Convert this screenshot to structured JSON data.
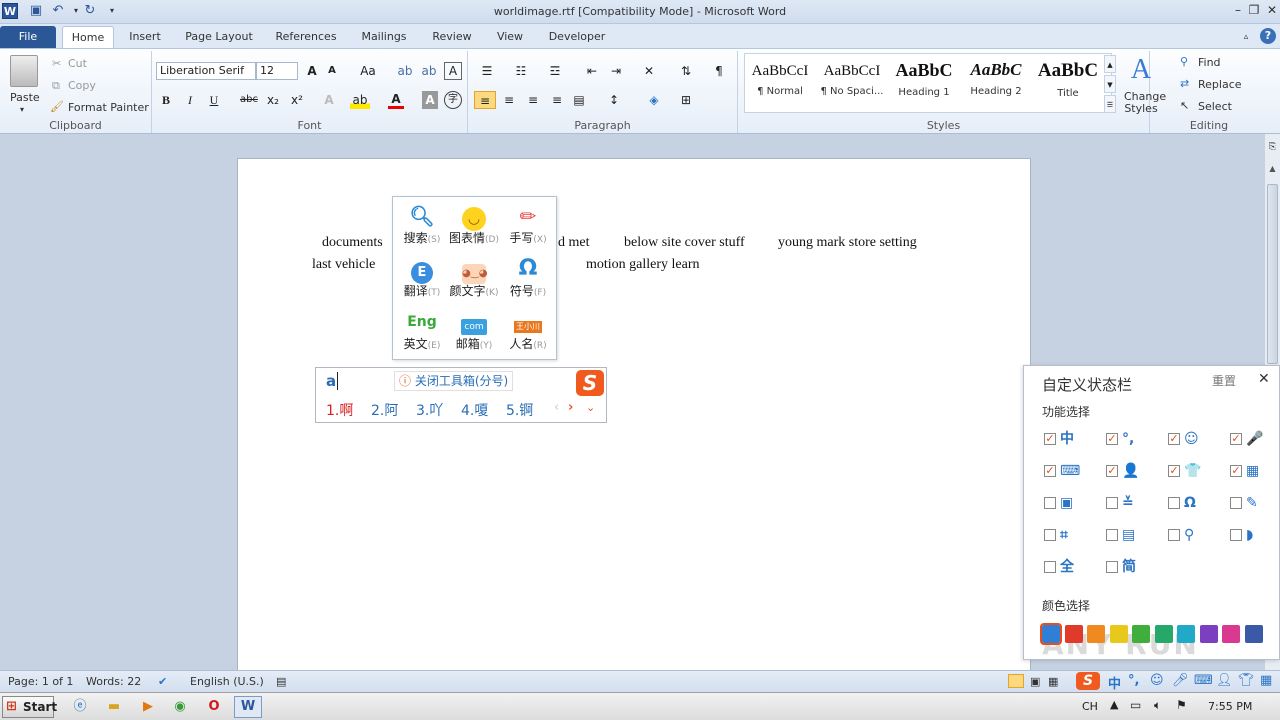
{
  "window": {
    "title": "worldimage.rtf [Compatibility Mode] - Microsoft Word",
    "app_icon": "W"
  },
  "tabs": [
    "File",
    "Home",
    "Insert",
    "Page Layout",
    "References",
    "Mailings",
    "Review",
    "View",
    "Developer"
  ],
  "clipboard": {
    "paste": "Paste",
    "cut": "Cut",
    "copy": "Copy",
    "format_painter": "Format Painter",
    "label": "Clipboard"
  },
  "font": {
    "name": "Liberation Serif",
    "size": "12",
    "label": "Font",
    "bold": "B",
    "italic": "I",
    "underline": "U",
    "strike": "abc",
    "sub": "x₂",
    "sup": "x²"
  },
  "paragraph": {
    "label": "Paragraph",
    "pilcrow": "¶"
  },
  "styles": {
    "label": "Styles",
    "items": [
      {
        "preview": "AaBbCcI",
        "name": "¶ Normal"
      },
      {
        "preview": "AaBbCcI",
        "name": "¶ No Spaci..."
      },
      {
        "preview": "AaBbC",
        "name": "Heading 1"
      },
      {
        "preview": "AaBbC",
        "name": "Heading 2"
      },
      {
        "preview": "AaBbC",
        "name": "Title"
      }
    ],
    "change_styles": "Change Styles"
  },
  "editing": {
    "label": "Editing",
    "find": "Find",
    "replace": "Replace",
    "select": "Select"
  },
  "document": {
    "line1_a": "documents",
    "line1_b": "d  met",
    "line1_c": "below  site  cover  stuff",
    "line1_d": "young  mark  store  setting",
    "line2_a": "last  vehicle",
    "line2_b": "motion  gallery  learn"
  },
  "ime_toolbox": {
    "tools": [
      {
        "label": "搜索",
        "key": "(S)",
        "icon": "search-icon"
      },
      {
        "label": "图表情",
        "key": "(D)",
        "icon": "smiley-icon"
      },
      {
        "label": "手写",
        "key": "(X)",
        "icon": "pencil-icon"
      },
      {
        "label": "翻译",
        "key": "(T)",
        "icon": "translate-icon"
      },
      {
        "label": "颜文字",
        "key": "(K)",
        "icon": "kaomoji-icon"
      },
      {
        "label": "符号",
        "key": "(F)",
        "icon": "omega-icon"
      },
      {
        "label": "英文",
        "key": "(E)",
        "icon": "english-icon"
      },
      {
        "label": "邮箱",
        "key": "(Y)",
        "icon": "email-icon"
      },
      {
        "label": "人名",
        "key": "(R)",
        "icon": "person-icon"
      }
    ],
    "badge_name": "王小川",
    "eng_icon": "Eng",
    "com_icon": "com"
  },
  "ime_candidates": {
    "input": "a",
    "close_hint": "关闭工具箱(分号)",
    "candidates": [
      "1.啊",
      "2.阿",
      "3.吖",
      "4.嗄",
      "5.锕"
    ]
  },
  "custom_panel": {
    "title": "自定义状态栏",
    "reset": "重置",
    "function_label": "功能选择",
    "color_label": "颜色选择",
    "items": [
      {
        "icon": "中",
        "checked": true
      },
      {
        "icon": "°,",
        "checked": true
      },
      {
        "icon": "☺",
        "checked": true
      },
      {
        "icon": "🎤",
        "checked": true
      },
      {
        "icon": "⌨",
        "checked": true
      },
      {
        "icon": "👤",
        "checked": true
      },
      {
        "icon": "👕",
        "checked": true
      },
      {
        "icon": "▦",
        "checked": true
      },
      {
        "icon": "▣",
        "checked": false
      },
      {
        "icon": "≚",
        "checked": false
      },
      {
        "icon": "Ω",
        "checked": false
      },
      {
        "icon": "✎",
        "checked": false
      },
      {
        "icon": "⌗",
        "checked": false
      },
      {
        "icon": "▤",
        "checked": false
      },
      {
        "icon": "⚲",
        "checked": false
      },
      {
        "icon": "◗",
        "checked": false
      },
      {
        "icon": "全",
        "checked": false
      },
      {
        "icon": "简",
        "checked": false
      }
    ],
    "colors": [
      "#2f7fd6",
      "#e03a2a",
      "#f08a20",
      "#e8c81a",
      "#3fae3a",
      "#25a86a",
      "#21a9c8",
      "#7b3fc0",
      "#d93a8f",
      "#3a5aa8"
    ]
  },
  "status": {
    "page": "Page: 1 of 1",
    "words": "Words: 22",
    "language": "English (U.S.)"
  },
  "taskbar": {
    "start": "Start",
    "lang": "CH",
    "time": "7:55 PM"
  },
  "watermark": "ANY RUN"
}
